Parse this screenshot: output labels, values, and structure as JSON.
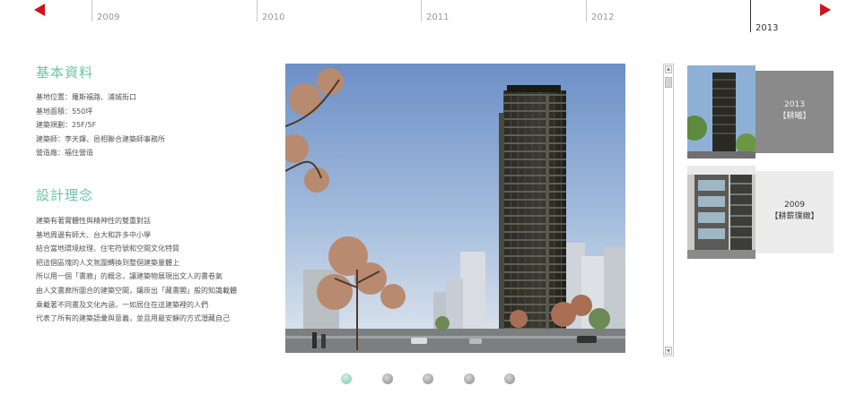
{
  "timeline": {
    "years": [
      "2009",
      "2010",
      "2011",
      "2012",
      "2013"
    ],
    "active": "2013"
  },
  "basic_info": {
    "title": "基本資料",
    "items": [
      "基地位置：羅斯福路、浦城街口",
      "基地面積：550坪",
      "建築規劃：25F/5F",
      "建築師：李天鐸、邑相聯合建築師事務所",
      "營造廠：福住營造"
    ]
  },
  "design_concept": {
    "title": "設計理念",
    "lines": [
      "建築有著實體性與精神性的雙重對話",
      "基地周邊有師大、台大和許多中小學",
      "結合當地環境紋理、住宅符號和空間文化特質",
      "把這個區塊的人文氛圍轉換到整個建築量體上",
      "所以用一個「書廊」的概念，讓建築物展現出文人的書卷氣",
      "由人文書廊所圍合的建築空間，鑲崁出「藏書閣」般的知識載體",
      "乘載著不同書及文化內涵，一如居住在這建築裡的人們",
      "代表了所有的建築語彙與意義，並且用最安靜的方式潛藏自己"
    ]
  },
  "projects": [
    {
      "year": "2013",
      "name": "【耕曦】"
    },
    {
      "year": "2009",
      "name": "【耕薪璞緻】"
    }
  ],
  "pager": {
    "count": 5,
    "active_index": 0
  },
  "colors": {
    "accent": "#6ac4a6",
    "arrow": "#d0121a",
    "card_active": "#8a8a8a",
    "card_inactive": "#ececec"
  }
}
